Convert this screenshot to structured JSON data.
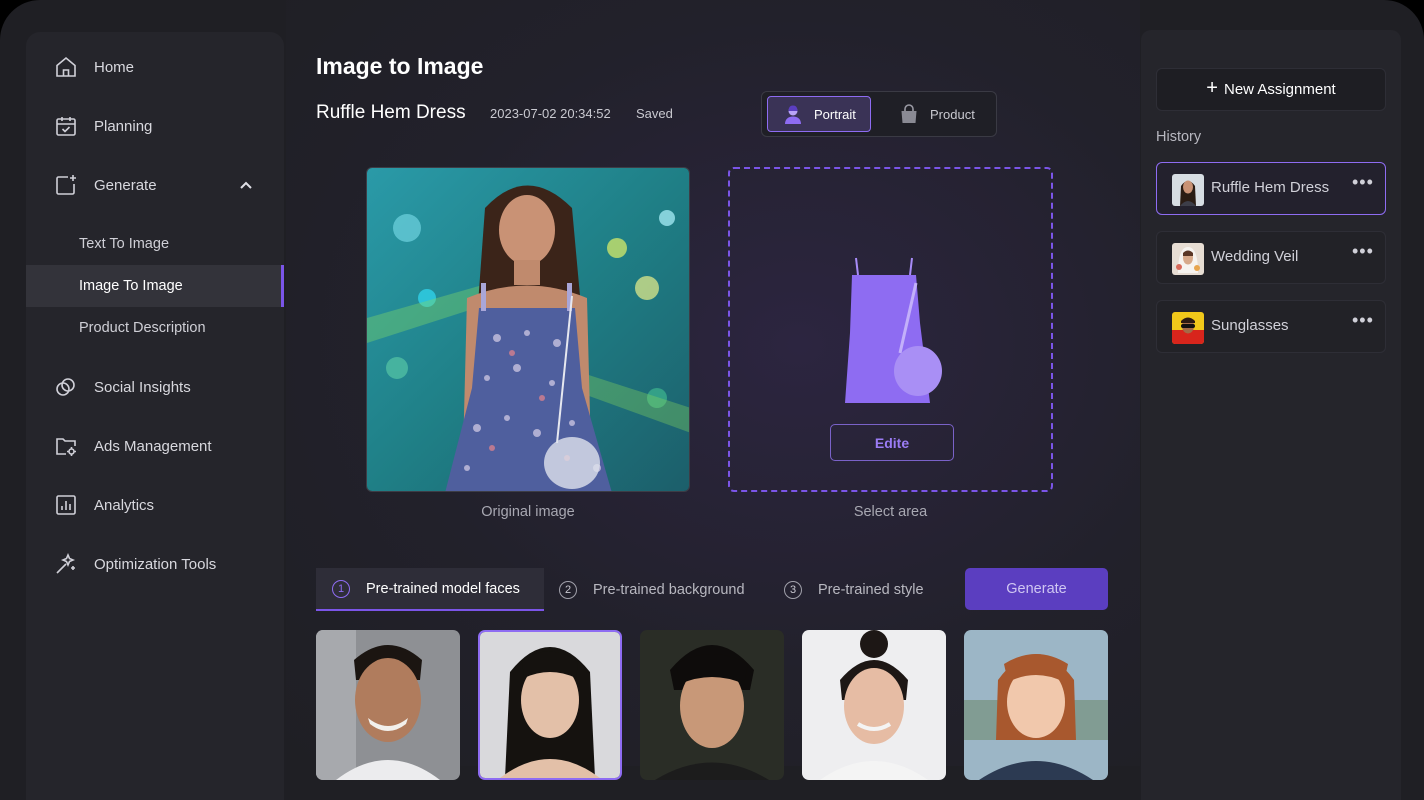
{
  "sidebar": {
    "nav": [
      {
        "label": "Home",
        "icon": "home-icon"
      },
      {
        "label": "Planning",
        "icon": "calendar-check-icon"
      },
      {
        "label": "Generate",
        "icon": "image-sparkle-icon"
      },
      {
        "label": "Social Insights",
        "icon": "rings-icon"
      },
      {
        "label": "Ads Management",
        "icon": "folder-gear-icon"
      },
      {
        "label": "Analytics",
        "icon": "bar-chart-icon"
      },
      {
        "label": "Optimization Tools",
        "icon": "magic-wand-icon"
      }
    ],
    "sub": [
      {
        "label": "Text To Image"
      },
      {
        "label": "Image To Image"
      },
      {
        "label": "Product Description"
      }
    ],
    "active_sub": "Image To Image",
    "expanded": "Generate"
  },
  "main": {
    "title": "Image to Image",
    "doc_name": "Ruffle Hem Dress",
    "timestamp": "2023-07-02 20:34:52",
    "status": "Saved",
    "mode_toggle": {
      "options": [
        {
          "label": "Portrait",
          "icon": "person-icon"
        },
        {
          "label": "Product",
          "icon": "bag-icon"
        }
      ],
      "selected": "Portrait"
    },
    "original_caption": "Original image",
    "select_caption": "Select area",
    "edit_label": "Edite",
    "steps": [
      {
        "num": "1",
        "label": "Pre-trained model faces"
      },
      {
        "num": "2",
        "label": "Pre-trained background"
      },
      {
        "num": "3",
        "label": "Pre-trained style"
      }
    ],
    "active_step": "1",
    "generate_label": "Generate",
    "faces_selected_index": 1
  },
  "right": {
    "new_label": "New Assignment",
    "history_label": "History",
    "history": [
      {
        "label": "Ruffle Hem Dress",
        "menu": "•••"
      },
      {
        "label": "Wedding Veil",
        "menu": "•••"
      },
      {
        "label": "Sunglasses",
        "menu": "•••"
      }
    ],
    "active_history": "Ruffle Hem Dress"
  },
  "colors": {
    "accent": "#7b55e8",
    "bg": "#1f1f24",
    "panel": "#25252b"
  }
}
